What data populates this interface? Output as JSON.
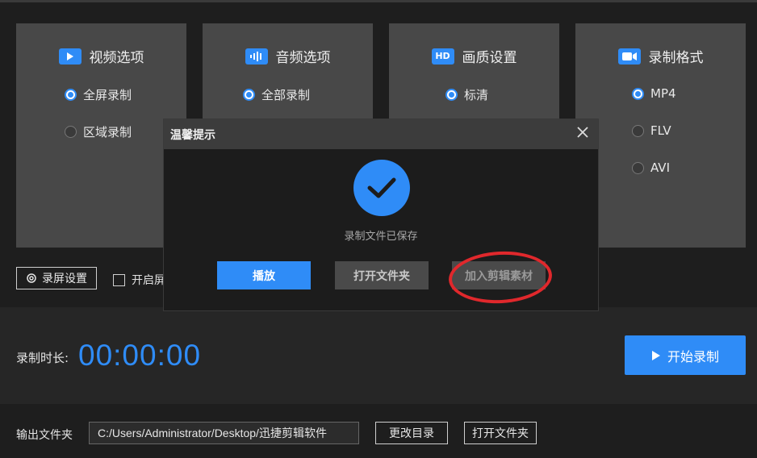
{
  "panels": [
    {
      "title": "视频选项",
      "icon": "video-icon",
      "options": [
        {
          "label": "全屏录制",
          "selected": true
        },
        {
          "label": "区域录制",
          "selected": false
        }
      ]
    },
    {
      "title": "音频选项",
      "icon": "audio-wave-icon",
      "options": [
        {
          "label": "全部录制",
          "selected": true
        }
      ]
    },
    {
      "title": "画质设置",
      "icon": "hd-icon",
      "icon_text": "HD",
      "options": [
        {
          "label": "标清",
          "selected": true
        }
      ]
    },
    {
      "title": "录制格式",
      "icon": "camera-icon",
      "options": [
        {
          "label": "MP4",
          "selected": true
        },
        {
          "label": "FLV",
          "selected": false
        },
        {
          "label": "AVI",
          "selected": false
        }
      ]
    }
  ],
  "toolbar": {
    "settings_label": "录屏设置",
    "checkbox_label": "开启屏"
  },
  "timer": {
    "label": "录制时长:",
    "value": "00:00:00"
  },
  "start_button": {
    "label": "开始录制"
  },
  "output": {
    "label": "输出文件夹",
    "path": "C:/Users/Administrator/Desktop/迅捷剪辑软件",
    "change_label": "更改目录",
    "open_label": "打开文件夹"
  },
  "dialog": {
    "title": "温馨提示",
    "message": "录制文件已保存",
    "play_label": "播放",
    "open_label": "打开文件夹",
    "add_label": "加入剪辑素材"
  },
  "colors": {
    "accent": "#2f8cf7",
    "annotation": "#e0282c"
  }
}
